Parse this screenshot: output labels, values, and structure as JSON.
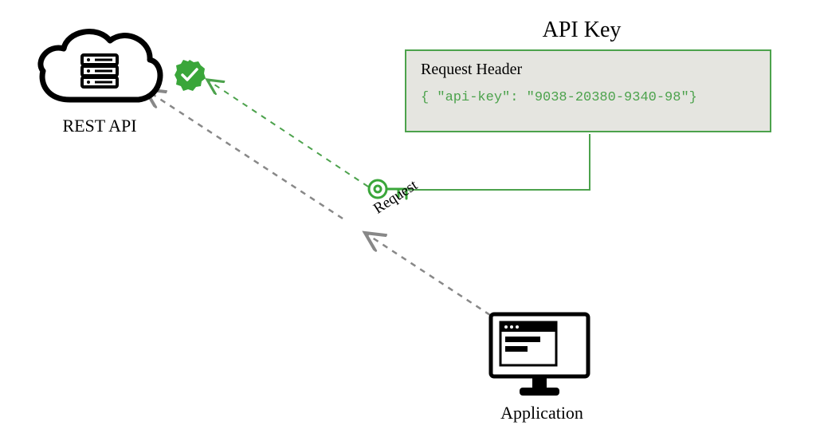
{
  "cloud": {
    "label": "REST API"
  },
  "api_key": {
    "title": "API Key"
  },
  "header_box": {
    "title": "Request Header",
    "code": "{ \"api-key\": \"9038-20380-9340-98\"}"
  },
  "request_label": "Request",
  "application": {
    "label": "Application"
  },
  "colors": {
    "green": "#4ca24c",
    "grey": "#888888",
    "bg_box": "#e5e5e0",
    "black": "#000000"
  }
}
